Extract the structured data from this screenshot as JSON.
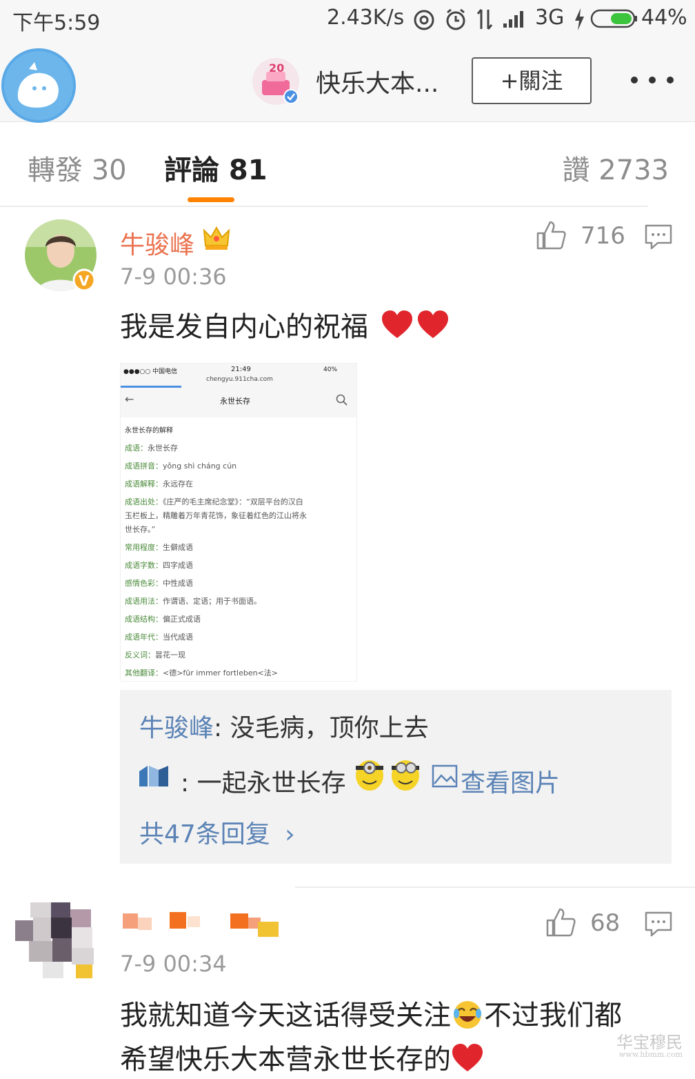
{
  "status_bar": {
    "time": "下午5:59",
    "speed": "2.43K/s",
    "network": "3G",
    "battery": "44%"
  },
  "header": {
    "title": "快乐大本...",
    "follow_label": "+關注"
  },
  "tabs": {
    "reposts": "轉發 30",
    "comments": "評論 81",
    "likes": "讚 2733"
  },
  "comments": [
    {
      "username": "牛骏峰",
      "time": "7-9 00:36",
      "likes": "716",
      "text": "我是发自内心的祝福",
      "image": {
        "status_time": "21:49",
        "status_carrier": "●●●○○ 中国电信 ",
        "status_battery": "40%",
        "url": "chengyu.911cha.com",
        "page_title": "永世长存",
        "section": "永世长存的解释",
        "rows": [
          {
            "k": "成语：",
            "v": "永世长存"
          },
          {
            "k": "成语拼音：",
            "v": "yǒng shì cháng cún"
          },
          {
            "k": "成语解释：",
            "v": "永远存在"
          },
          {
            "k": "成语出处：",
            "v": "《庄严的毛主席纪念堂》：“双层平台的汉白"
          },
          {
            "k": "",
            "v": "玉栏板上，精雕着万年青花饰，象征着红色的江山将永"
          },
          {
            "k": "",
            "v": "世长存。”"
          },
          {
            "k": "常用程度：",
            "v": "生僻成语"
          },
          {
            "k": "成语字数：",
            "v": "四字成语"
          },
          {
            "k": "感情色彩：",
            "v": "中性成语"
          },
          {
            "k": "成语用法：",
            "v": "作谓语、定语；用于书面语。"
          },
          {
            "k": "成语结构：",
            "v": "偏正式成语"
          },
          {
            "k": "成语年代：",
            "v": "当代成语"
          },
          {
            "k": "反义词：",
            "v": "昙花一现"
          },
          {
            "k": "其他翻译：",
            "v": "<德>für immer fortleben<法>"
          }
        ]
      },
      "replies": [
        {
          "name": "牛骏峰",
          "sep": ":",
          "text": "没毛病，顶你上去"
        },
        {
          "name": "",
          "sep": ":",
          "text": "一起永世长存",
          "link": "查看图片"
        }
      ],
      "more_replies": "共47条回复"
    },
    {
      "username": "",
      "time": "7-9 00:34",
      "likes": "68",
      "text_line1": "我就知道今天这话得受关注",
      "text_line1b": "不过我们都",
      "text_line2": "希望快乐大本营永世长存的"
    }
  ],
  "watermark": {
    "text": "华宝穆民",
    "url": "www.hbmm.com"
  },
  "colors": {
    "accent": "#ff8200",
    "username": "#eb7350",
    "link": "#5b83b6",
    "heart": "#e0262c"
  }
}
